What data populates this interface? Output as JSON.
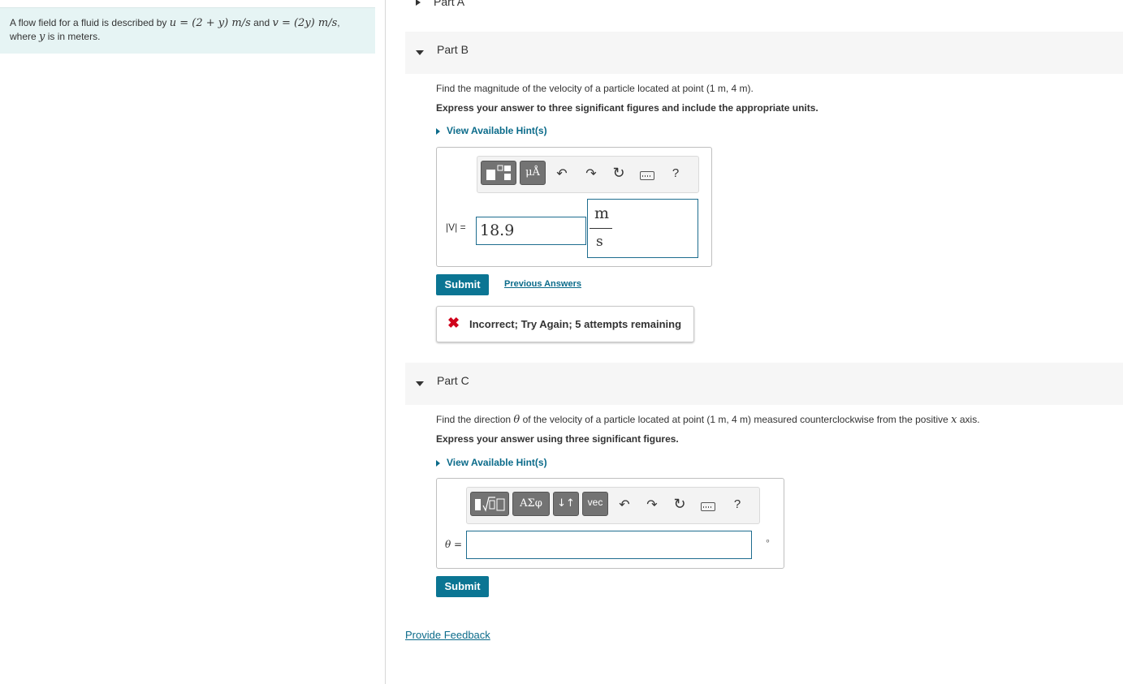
{
  "problem": {
    "text1": "A flow field for a fluid is described by",
    "u_expr": "u = (2 + y) m/s",
    "and": "and",
    "v_expr": "v = (2y) m/s",
    "text2": "where",
    "y_var": "y",
    "text3": "is in meters."
  },
  "part_a": {
    "label": "Part A"
  },
  "part_b": {
    "label": "Part B",
    "question": "Find the magnitude of the velocity of a particle located at point (1 m, 4 m).",
    "instruction": "Express your answer to three significant figures and include the appropriate units.",
    "hint_label": "View Available Hint(s)",
    "toolbar": {
      "mu_label": "μÅ",
      "help": "?"
    },
    "var_label": "|V| =",
    "value": "18.9",
    "unit_num": "m",
    "unit_den": "s",
    "submit_label": "Submit",
    "previous_answers_label": "Previous Answers",
    "feedback": "Incorrect; Try Again; 5 attempts remaining"
  },
  "part_c": {
    "label": "Part C",
    "question_a": "Find the direction",
    "theta": "θ",
    "question_b": "of the velocity of a particle located at point (1 m, 4 m) measured counterclockwise from the positive",
    "x_var": "x",
    "question_c": "axis.",
    "instruction": "Express your answer using three significant figures.",
    "hint_label": "View Available Hint(s)",
    "toolbar": {
      "greek_label": "ΑΣφ",
      "arrows_label": "↓↑",
      "vec_label": "vec",
      "help": "?"
    },
    "var_label": "θ =",
    "value": "",
    "unit": "∘",
    "submit_label": "Submit"
  },
  "footer": {
    "provide_feedback": "Provide Feedback"
  }
}
